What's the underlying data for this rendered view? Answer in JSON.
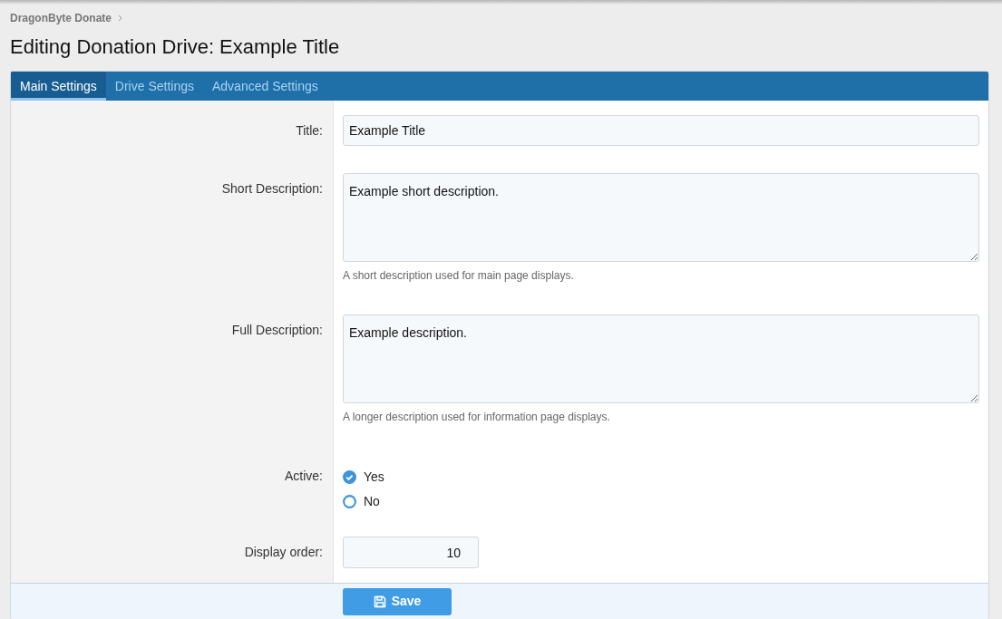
{
  "breadcrumb": [
    {
      "label": "DragonByte Donate"
    }
  ],
  "title": "Editing Donation Drive: Example Title",
  "tabs": [
    {
      "label": "Main Settings",
      "selected": true
    },
    {
      "label": "Drive Settings",
      "selected": false
    },
    {
      "label": "Advanced Settings",
      "selected": false
    }
  ],
  "fields": [
    {
      "kind": "text",
      "label": "Title:",
      "value": "Example Title"
    },
    {
      "kind": "textarea",
      "label": "Short Description:",
      "value": "Example short description.",
      "hint": "A short description used for main page displays."
    },
    {
      "kind": "textarea",
      "label": "Full Description:",
      "value": "Example description.",
      "hint": "A longer description used for information page displays."
    },
    {
      "kind": "radio",
      "label": "Active:",
      "options": [
        {
          "label": "Yes",
          "selected": true
        },
        {
          "label": "No",
          "selected": false
        }
      ]
    },
    {
      "kind": "number",
      "label": "Display order:",
      "value": "10"
    }
  ],
  "save_button": "Save"
}
